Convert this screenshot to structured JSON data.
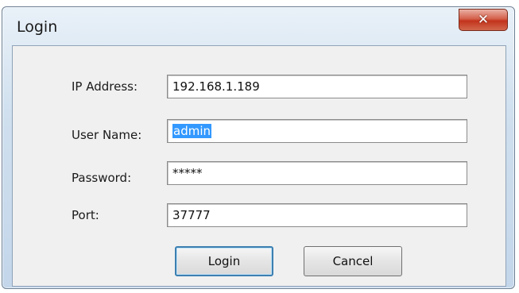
{
  "window": {
    "title": "Login",
    "close_icon": "close-icon"
  },
  "form": {
    "ip_label": "IP Address:",
    "ip_value": "192.168.1.189",
    "user_label": "User Name:",
    "user_value": "admin",
    "password_label": "Password:",
    "password_value": "*****",
    "port_label": "Port:",
    "port_value": "37777"
  },
  "buttons": {
    "login_label": "Login",
    "cancel_label": "Cancel"
  },
  "colors": {
    "selection": "#3399ff",
    "close_button": "#c2331c",
    "default_button_border": "#3c7fb1"
  }
}
